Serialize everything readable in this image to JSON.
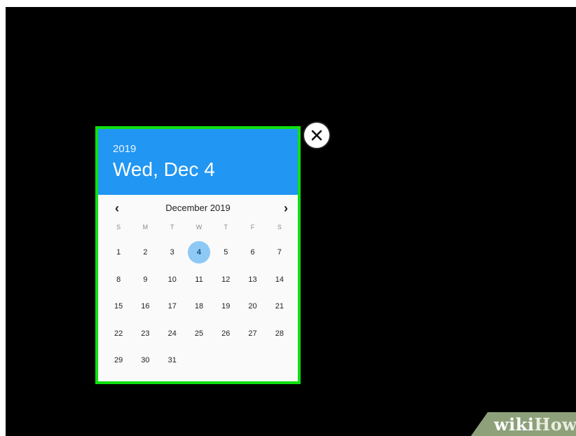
{
  "date_picker": {
    "year": "2019",
    "selected_date_label": "Wed, Dec 4",
    "month_label": "December 2019",
    "prev_icon": "chevron-left-icon",
    "next_icon": "chevron-right-icon",
    "weekdays": [
      "S",
      "M",
      "T",
      "W",
      "T",
      "F",
      "S"
    ],
    "weeks": [
      [
        "1",
        "2",
        "3",
        "4",
        "5",
        "6",
        "7"
      ],
      [
        "8",
        "9",
        "10",
        "11",
        "12",
        "13",
        "14"
      ],
      [
        "15",
        "16",
        "17",
        "18",
        "19",
        "20",
        "21"
      ],
      [
        "22",
        "23",
        "24",
        "25",
        "26",
        "27",
        "28"
      ],
      [
        "29",
        "30",
        "31",
        "",
        "",
        "",
        ""
      ]
    ],
    "selected_day": "4",
    "header_color": "#2196f3",
    "selection_color": "#8ec8f5",
    "highlight_border_color": "#0fe00f"
  },
  "close_button": {
    "icon": "close-icon"
  },
  "watermark": {
    "text_a": "wiki",
    "text_b": "How"
  }
}
